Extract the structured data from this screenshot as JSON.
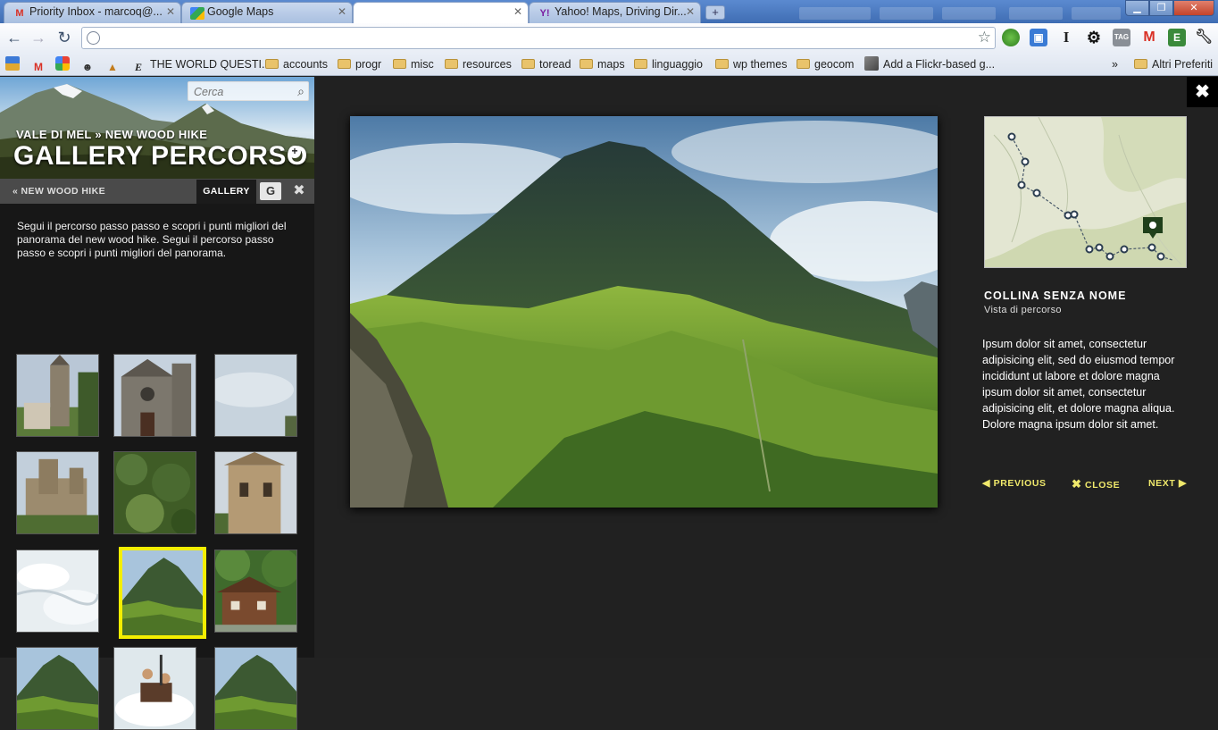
{
  "browser": {
    "tabs": [
      {
        "title": "Priority Inbox - marcoq@...",
        "icon": "gmail-icon"
      },
      {
        "title": "Google Maps",
        "icon": "google-maps-icon"
      },
      {
        "title": "",
        "icon": ""
      },
      {
        "title": "Yahoo! Maps, Driving Dir...",
        "icon": "yahoo-icon"
      }
    ],
    "address": "",
    "bookmarks": [
      {
        "label": "",
        "kind": "icon",
        "icon": "photo-icon"
      },
      {
        "label": "",
        "kind": "icon",
        "icon": "gmail-icon"
      },
      {
        "label": "",
        "kind": "icon",
        "icon": "picasa-icon"
      },
      {
        "label": "",
        "kind": "icon",
        "icon": "reddit-icon"
      },
      {
        "label": "",
        "kind": "icon",
        "icon": "money-icon"
      },
      {
        "label": "THE WORLD QUESTI...",
        "kind": "link",
        "icon": "e-icon"
      },
      {
        "label": "accounts",
        "kind": "folder"
      },
      {
        "label": "progr",
        "kind": "folder"
      },
      {
        "label": "misc",
        "kind": "folder"
      },
      {
        "label": "resources",
        "kind": "folder"
      },
      {
        "label": "toread",
        "kind": "folder"
      },
      {
        "label": "maps",
        "kind": "folder"
      },
      {
        "label": "linguaggio",
        "kind": "folder"
      },
      {
        "label": "wp themes",
        "kind": "folder"
      },
      {
        "label": "geocom",
        "kind": "folder"
      },
      {
        "label": "Add a Flickr-based g...",
        "kind": "link",
        "icon": "flickr-icon"
      }
    ],
    "more": "»",
    "other_bookmarks": "Altri Preferiti"
  },
  "sidebar": {
    "search_placeholder": "Cerca",
    "breadcrumb": "VALE DI MEL » NEW WOOD HIKE",
    "title": "GALLERY PERCORSO",
    "back_link": "« NEW WOOD HIKE",
    "tab_gallery": "GALLERY",
    "g_button": "G",
    "description": "Segui il percorso passo passo e scopri i punti migliori del panorama del new wood hike. Segui il percorso passo passo e scopri i punti migliori del panorama.",
    "thumbnails": [
      {
        "subject": "church-tower"
      },
      {
        "subject": "stone-church"
      },
      {
        "subject": "sky"
      },
      {
        "subject": "castle"
      },
      {
        "subject": "foliage"
      },
      {
        "subject": "stone-house"
      },
      {
        "subject": "white-water"
      },
      {
        "subject": "green-mountain",
        "selected": true
      },
      {
        "subject": "wooden-chalet"
      },
      {
        "subject": "green-mountain"
      },
      {
        "subject": "rafting"
      },
      {
        "subject": "green-mountain"
      }
    ]
  },
  "viewer": {
    "title": "COLLINA SENZA NOME",
    "subtitle": "Vista di percorso",
    "description": "Ipsum dolor sit amet, consectetur adipisicing elit, sed do eiusmod tempor incididunt ut labore et dolore magna ipsum dolor sit amet, consectetur adipisicing elit, et dolore magna aliqua. Dolore magna ipsum dolor sit amet.",
    "previous": "PREVIOUS",
    "close": "CLOSE",
    "next": "NEXT"
  },
  "colors": {
    "highlight": "#f4ee00",
    "nav_text": "#efe86b",
    "page_bg": "#212121",
    "sidebar_bg": "#171717"
  }
}
